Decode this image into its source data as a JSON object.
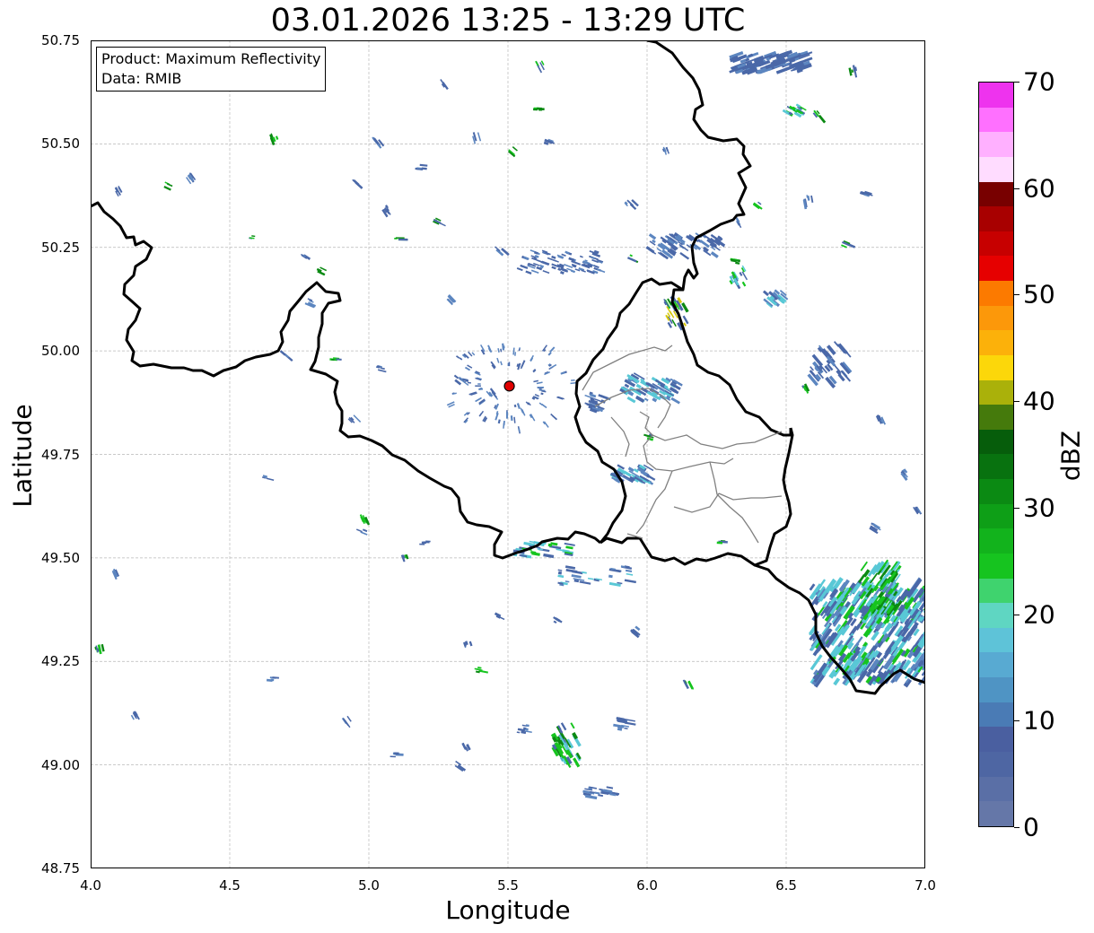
{
  "title": "03.01.2026 13:25 - 13:29 UTC",
  "xlabel": "Longitude",
  "ylabel": "Latitude",
  "x_ticks": [
    "4.0",
    "4.5",
    "5.0",
    "5.5",
    "6.0",
    "6.5",
    "7.0"
  ],
  "y_ticks": [
    "50.75",
    "50.50",
    "50.25",
    "50.00",
    "49.75",
    "49.50",
    "49.25",
    "49.00",
    "48.75"
  ],
  "info": {
    "product": "Product: Maximum Reflectivity",
    "data": "Data: RMIB"
  },
  "map": {
    "lon_range": [
      4.0,
      7.0
    ],
    "lat_range": [
      48.75,
      50.75
    ],
    "radar_site": {
      "lon": 5.505,
      "lat": 49.915,
      "color": "#e00000"
    },
    "grid": true
  },
  "colorbar": {
    "label": "dBZ",
    "ticks": [
      "0",
      "10",
      "20",
      "30",
      "40",
      "50",
      "60",
      "70"
    ],
    "range": [
      0,
      70
    ],
    "step": 2.5,
    "colors": [
      "#6577a8",
      "#5a6fa6",
      "#4e66a3",
      "#4a5fa0",
      "#4a7bb5",
      "#4f94c4",
      "#58aad2",
      "#5ec3d8",
      "#5fd6c2",
      "#3fd36e",
      "#16c41f",
      "#12b31c",
      "#0e9f17",
      "#0b8a13",
      "#08720f",
      "#065d0b",
      "#457a0c",
      "#aab10a",
      "#fcd70a",
      "#fcb10a",
      "#fc980a",
      "#fc7a00",
      "#e60000",
      "#c70000",
      "#a80000",
      "#780000",
      "#ffdcff",
      "#ffb0ff",
      "#ff70ff",
      "#ee33ee"
    ]
  },
  "radar_colors": {
    "light": "#4a68a8",
    "light2": "#5c86c0",
    "cyan": "#59c8d6",
    "green": "#16c41f",
    "dgreen": "#0b8a13",
    "yellow": "#d6c80a",
    "orange": "#fc980a"
  }
}
